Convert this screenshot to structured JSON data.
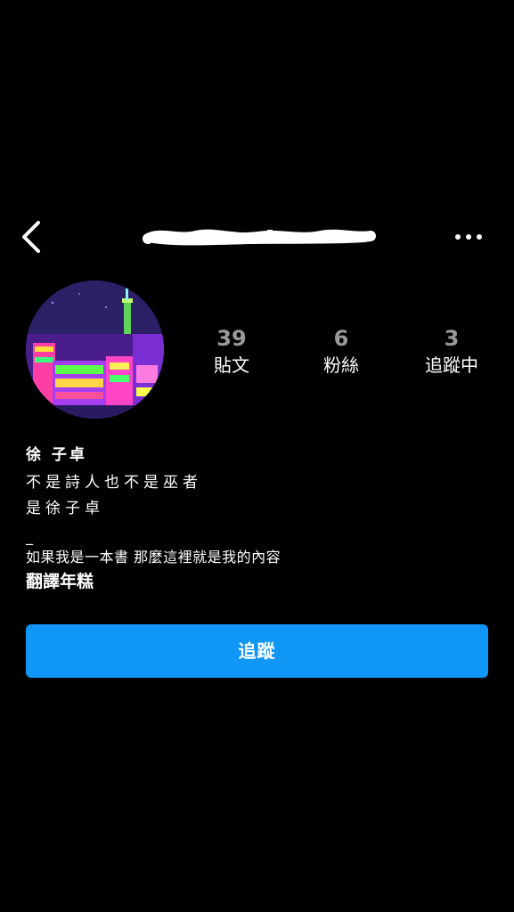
{
  "header": {
    "back_icon": "chevron-left-icon",
    "username_redacted": true,
    "more_icon": "more-horizontal-icon"
  },
  "profile": {
    "avatar_icon": "avatar-neon-city",
    "stats": [
      {
        "count": "39",
        "label": "貼文"
      },
      {
        "count": "6",
        "label": "粉絲"
      },
      {
        "count": "3",
        "label": "追蹤中"
      }
    ]
  },
  "bio": {
    "name": "徐 子卓",
    "lines": [
      "不是詩人也不是巫者",
      "是徐子卓"
    ],
    "dash": "_",
    "tagline": "如果我是一本書 那麼這裡就是我的內容",
    "link": "翻譯年糕"
  },
  "actions": {
    "follow_label": "追蹤"
  },
  "colors": {
    "background": "#000000",
    "accent": "#0F96F7",
    "count_text": "#9A9A9A"
  }
}
